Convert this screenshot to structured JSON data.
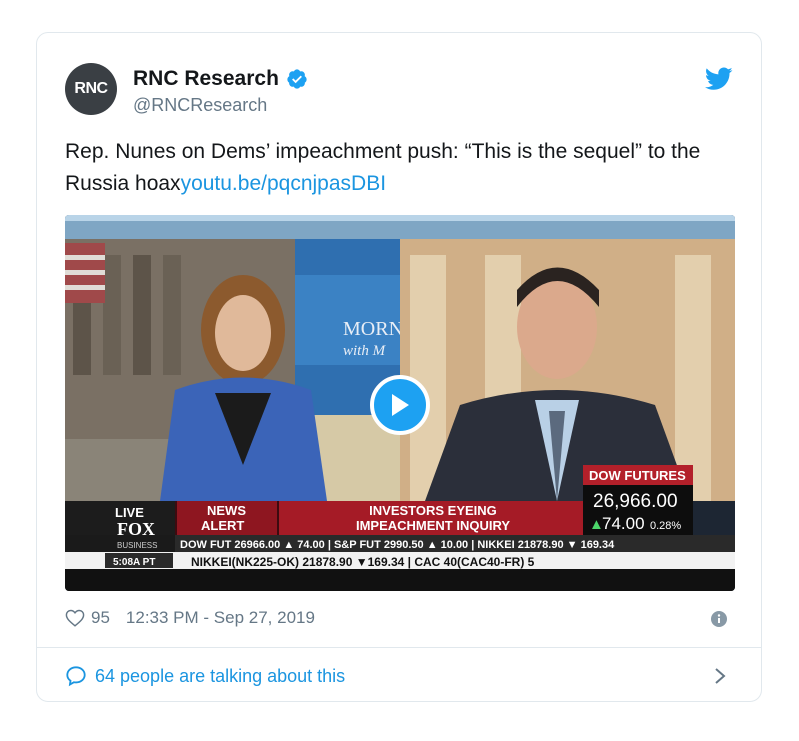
{
  "tweet": {
    "author_name": "RNC Research",
    "author_handle": "@RNCResearch",
    "avatar_text": "RNC",
    "text": "Rep. Nunes on Dems’ impeachment push: “This is the sequel” to the Russia hoax",
    "link_text": "youtu.be/pqcnjpasDBI",
    "likes": "95",
    "timestamp": "12:33 PM - Sep 27, 2019",
    "talking_text": "64 people are talking about this"
  },
  "media": {
    "show_logo_line1": "MORN",
    "show_logo_line2": "with M",
    "live_label": "LIVE",
    "network_label": "FOX",
    "network_sub": "BUSINESS",
    "clock": "5:08A PT",
    "news_alert_line1": "NEWS",
    "news_alert_line2": "ALERT",
    "headline_line1": "INVESTORS EYEING",
    "headline_line2": "IMPEACHMENT INQUIRY",
    "futures_label": "DOW FUTURES",
    "futures_value": "26,966.00",
    "futures_change": "74.00",
    "futures_pct": "0.28%",
    "ticker1": "DOW FUT  26966.00 ▲ 74.00 | S&P FUT  2990.50 ▲ 10.00 | NIKKEI  21878.90 ▼ 169.34",
    "ticker2": "NIKKEI(NK225-OK) 21878.90 ▼169.34  |  CAC 40(CAC40-FR) 5"
  },
  "colors": {
    "link": "#1b95e0",
    "muted": "#657786",
    "verified": "#1da1f2"
  }
}
